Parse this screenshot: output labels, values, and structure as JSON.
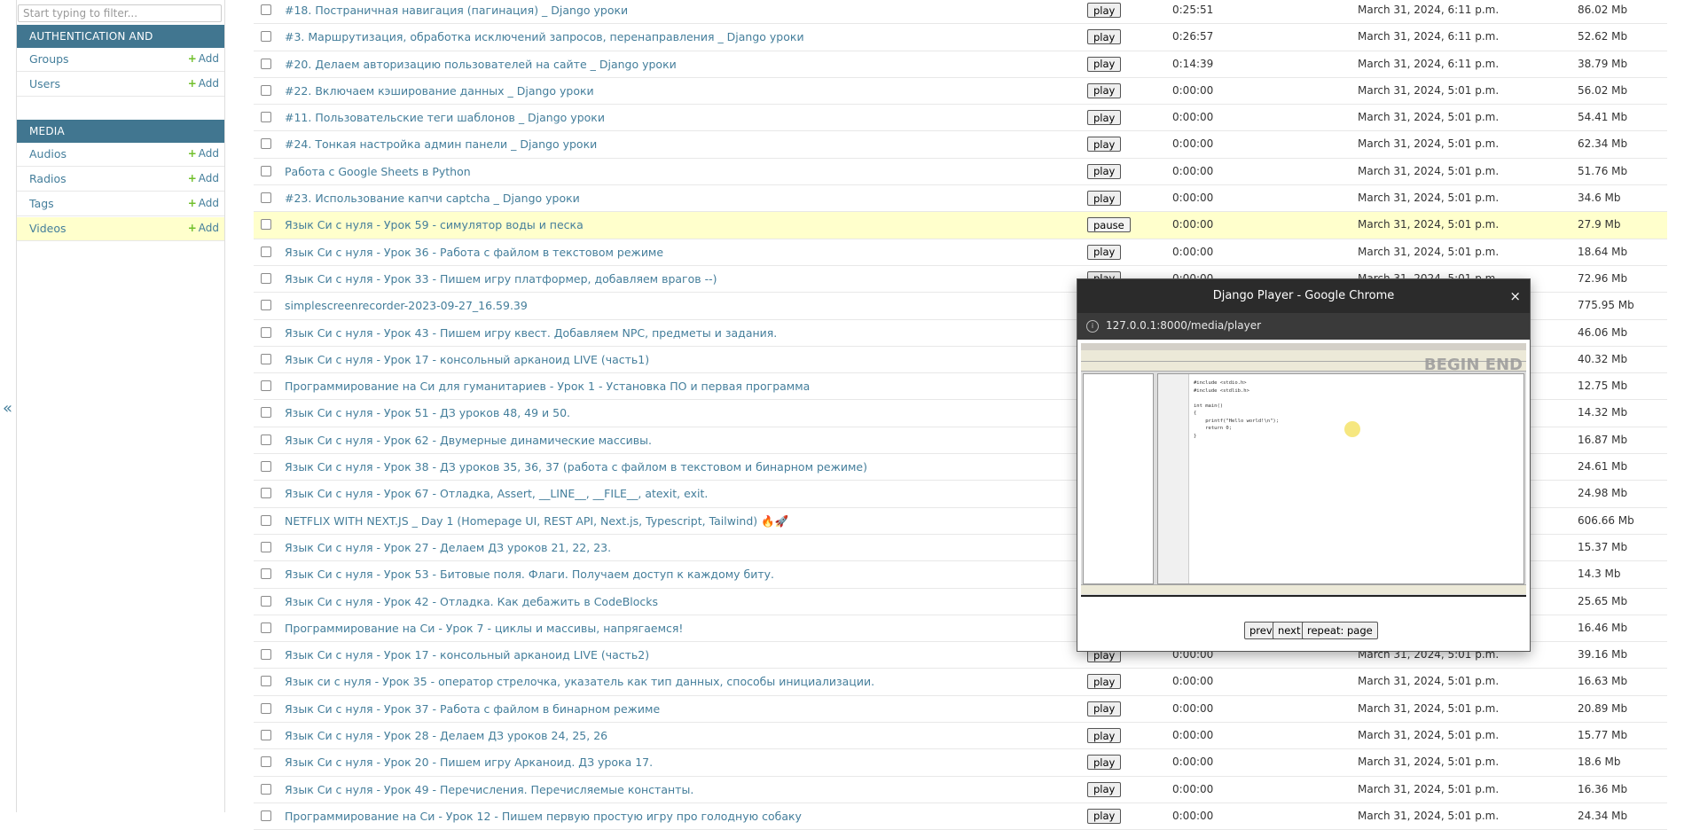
{
  "sidebar": {
    "filter_placeholder": "Start typing to filter...",
    "collapse_glyph": "«",
    "apps": [
      {
        "caption": "AUTHENTICATION AND AUTHORIZATION",
        "models": [
          {
            "name": "Groups",
            "add": "Add"
          },
          {
            "name": "Users",
            "add": "Add"
          }
        ]
      },
      {
        "caption": "MEDIA",
        "models": [
          {
            "name": "Audios",
            "add": "Add"
          },
          {
            "name": "Radios",
            "add": "Add"
          },
          {
            "name": "Tags",
            "add": "Add"
          },
          {
            "name": "Videos",
            "add": "Add",
            "current": true
          }
        ]
      }
    ]
  },
  "rows": [
    {
      "title": "#18. Постраничная навигация (пагинация) _ Django уроки",
      "btn": "play",
      "duration": "0:25:51",
      "date": "March 31, 2024, 6:11 p.m.",
      "size": "86.02 Mb"
    },
    {
      "title": "#3. Маршрутизация, обработка исключений запросов, перенаправления _ Django уроки",
      "btn": "play",
      "duration": "0:26:57",
      "date": "March 31, 2024, 6:11 p.m.",
      "size": "52.62 Mb"
    },
    {
      "title": "#20. Делаем авторизацию пользователей на сайте _ Django уроки",
      "btn": "play",
      "duration": "0:14:39",
      "date": "March 31, 2024, 6:11 p.m.",
      "size": "38.79 Mb"
    },
    {
      "title": "#22. Включаем кэширование данных _ Django уроки",
      "btn": "play",
      "duration": "0:00:00",
      "date": "March 31, 2024, 5:01 p.m.",
      "size": "56.02 Mb"
    },
    {
      "title": "#11. Пользовательские теги шаблонов _ Django уроки",
      "btn": "play",
      "duration": "0:00:00",
      "date": "March 31, 2024, 5:01 p.m.",
      "size": "54.41 Mb"
    },
    {
      "title": "#24. Тонкая настройка админ панели _ Django уроки",
      "btn": "play",
      "duration": "0:00:00",
      "date": "March 31, 2024, 5:01 p.m.",
      "size": "62.34 Mb"
    },
    {
      "title": "Работа с Google Sheets в Python",
      "btn": "play",
      "duration": "0:00:00",
      "date": "March 31, 2024, 5:01 p.m.",
      "size": "51.76 Mb"
    },
    {
      "title": "#23. Использование капчи captcha _ Django уроки",
      "btn": "play",
      "duration": "0:00:00",
      "date": "March 31, 2024, 5:01 p.m.",
      "size": "34.6 Mb"
    },
    {
      "title": "Язык Си с нуля - Урок 59 - симулятор воды и песка",
      "btn": "pause",
      "duration": "0:00:00",
      "date": "March 31, 2024, 5:01 p.m.",
      "size": "27.9 Mb",
      "selected": true
    },
    {
      "title": "Язык Си с нуля - Урок 36 - Работа с файлом в текстовом режиме",
      "btn": "play",
      "duration": "0:00:00",
      "date": "March 31, 2024, 5:01 p.m.",
      "size": "18.64 Mb"
    },
    {
      "title": "Язык Си с нуля - Урок 33 - Пишем игру платформер, добавляем врагов --)",
      "btn": "play",
      "duration": "0:00:00",
      "date": "March 31, 2024, 5:01 p.m.",
      "size": "72.96 Mb"
    },
    {
      "title": "simplescreenrecorder-2023-09-27_16.59.39",
      "btn": "",
      "duration": "",
      "date": "",
      "size": "775.95 Mb"
    },
    {
      "title": "Язык Си с нуля - Урок 43 - Пишем игру квест. Добавляем NPC, предметы и задания.",
      "btn": "",
      "duration": "",
      "date": "",
      "size": "46.06 Mb"
    },
    {
      "title": "Язык Си с нуля - Урок 17 - консольный арканоид LIVE (часть1)",
      "btn": "",
      "duration": "",
      "date": "",
      "size": "40.32 Mb"
    },
    {
      "title": "Программирование на Си для гуманитариев - Урок 1 - Установка ПО и первая программа",
      "btn": "",
      "duration": "",
      "date": "",
      "size": "12.75 Mb"
    },
    {
      "title": "Язык Си с нуля - Урок 51 - ДЗ уроков 48, 49 и 50.",
      "btn": "",
      "duration": "",
      "date": "",
      "size": "14.32 Mb"
    },
    {
      "title": "Язык Си с нуля - Урок 62 - Двумерные динамические массивы.",
      "btn": "",
      "duration": "",
      "date": "",
      "size": "16.87 Mb"
    },
    {
      "title": "Язык Си с нуля - Урок 38 - ДЗ уроков 35, 36, 37 (работа с файлом в текстовом и бинарном режиме)",
      "btn": "",
      "duration": "",
      "date": "",
      "size": "24.61 Mb"
    },
    {
      "title": "Язык Си с нуля - Урок 67 - Отладка, Assert, __LINE__, __FILE__, atexit, exit.",
      "btn": "",
      "duration": "",
      "date": "",
      "size": "24.98 Mb"
    },
    {
      "title": "NETFLIX WITH NEXT.JS _ Day 1 (Homepage UI, REST API, Next.js, Typescript, Tailwind) 🔥🚀",
      "btn": "",
      "duration": "",
      "date": "",
      "size": "606.66 Mb"
    },
    {
      "title": "Язык Си с нуля - Урок 27 - Делаем ДЗ уроков 21, 22, 23.",
      "btn": "",
      "duration": "",
      "date": "",
      "size": "15.37 Mb"
    },
    {
      "title": "Язык Си с нуля - Урок 53 - Битовые поля. Флаги. Получаем доступ к каждому биту.",
      "btn": "",
      "duration": "",
      "date": "",
      "size": "14.3 Mb"
    },
    {
      "title": "Язык Си с нуля - Урок 42 - Отладка. Как дебажить в CodeBlocks",
      "btn": "",
      "duration": "",
      "date": "",
      "size": "25.65 Mb"
    },
    {
      "title": "Программирование на Си - Урок 7 - циклы и массивы, напрягаемся!",
      "btn": "",
      "duration": "",
      "date": "",
      "size": "16.46 Mb"
    },
    {
      "title": "Язык Си с нуля - Урок 17 - консольный арканоид LIVE (часть2)",
      "btn": "play",
      "duration": "0:00:00",
      "date": "March 31, 2024, 5:01 p.m.",
      "size": "39.16 Mb"
    },
    {
      "title": "Язык си с нуля - Урок 35 - оператор стрелочка, указатель как тип данных, способы инициализации.",
      "btn": "play",
      "duration": "0:00:00",
      "date": "March 31, 2024, 5:01 p.m.",
      "size": "16.63 Mb"
    },
    {
      "title": "Язык Си с нуля - Урок 37 - Работа с файлом в бинарном режиме",
      "btn": "play",
      "duration": "0:00:00",
      "date": "March 31, 2024, 5:01 p.m.",
      "size": "20.89 Mb"
    },
    {
      "title": "Язык Си с нуля - Урок 28 - Делаем ДЗ уроков 24, 25, 26",
      "btn": "play",
      "duration": "0:00:00",
      "date": "March 31, 2024, 5:01 p.m.",
      "size": "15.77 Mb"
    },
    {
      "title": "Язык Си с нуля - Урок 20 - Пишем игру Арканоид. ДЗ урока 17.",
      "btn": "play",
      "duration": "0:00:00",
      "date": "March 31, 2024, 5:01 p.m.",
      "size": "18.6 Mb"
    },
    {
      "title": "Язык Си с нуля - Урок 49 - Перечисления. Перечисляемые константы.",
      "btn": "play",
      "duration": "0:00:00",
      "date": "March 31, 2024, 5:01 p.m.",
      "size": "16.36 Mb"
    },
    {
      "title": "Программирование на Си - Урок 12 - Пишем первую простую игру про голодную собаку",
      "btn": "play",
      "duration": "0:00:00",
      "date": "March 31, 2024, 5:01 p.m.",
      "size": "24.34 Mb"
    }
  ],
  "popup": {
    "window_title": "Django Player - Google Chrome",
    "close_glyph": "×",
    "info_glyph": "i",
    "url": "127.0.0.1:8000/media/player",
    "video": {
      "logo": "BEGIN END",
      "code": "#include <stdio.h>\n#include <stdlib.h>\n\nint main()\n{\n    printf(\"Hello world!\\n\");\n    return 0;\n}"
    },
    "controls": {
      "prev": "prev",
      "next": "next",
      "repeat": "repeat: page"
    }
  }
}
